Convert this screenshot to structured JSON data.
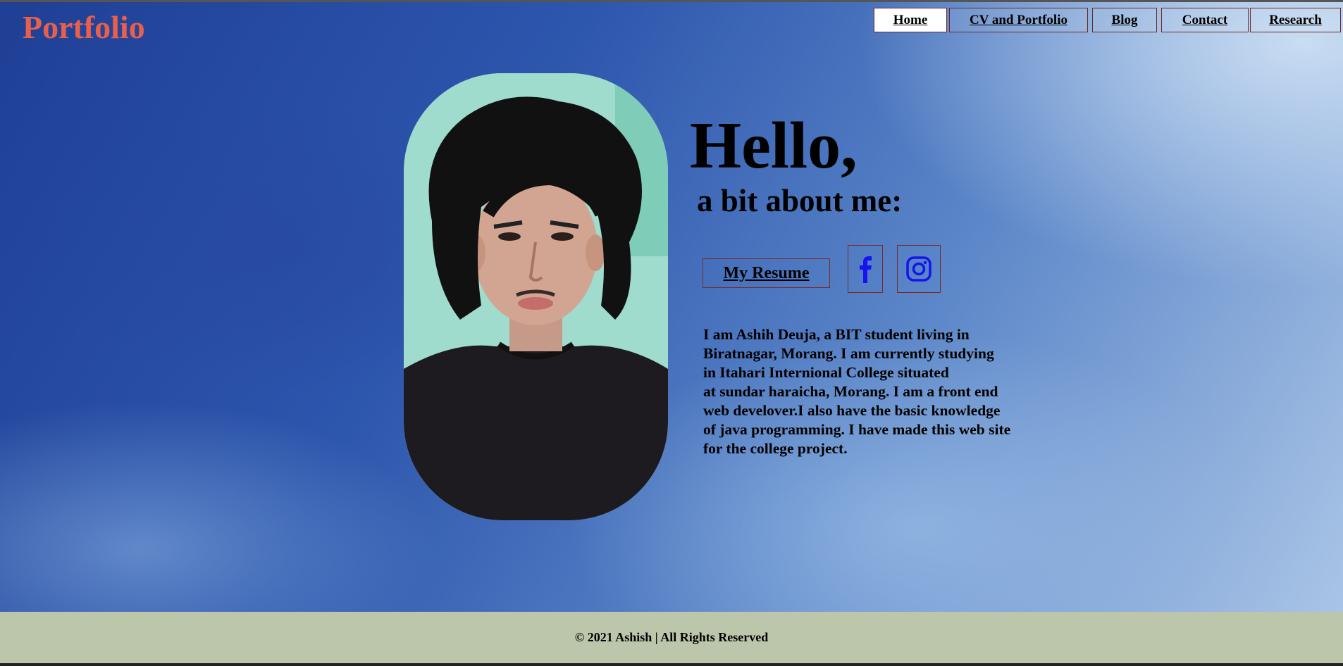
{
  "brand": {
    "title": "Portfolio",
    "color": "#e8604c"
  },
  "nav": {
    "items": [
      {
        "label": "Home",
        "active": true
      },
      {
        "label": "CV and Portfolio",
        "active": false
      },
      {
        "label": "Blog",
        "active": false
      },
      {
        "label": "Contact",
        "active": false
      },
      {
        "label": "Research",
        "active": false
      }
    ]
  },
  "hero": {
    "greeting": "Hello,",
    "subheading": "a bit about me:",
    "resume_label": "My Resume",
    "social_icons": [
      "facebook-icon",
      "instagram-icon"
    ],
    "about_lines": [
      "I am Ashih Deuja, a BIT student living in",
      "Biratnagar, Morang. I am currently studying",
      "in Itahari Internional College situated",
      "at sundar haraicha, Morang. I am a front end",
      "web develover.I also have the basic knowledge",
      "of java programming. I have made this web site",
      "for the college project."
    ]
  },
  "footer": {
    "text": "© 2021 Ashish | All Rights Reserved",
    "background": "#bcc6aa"
  }
}
